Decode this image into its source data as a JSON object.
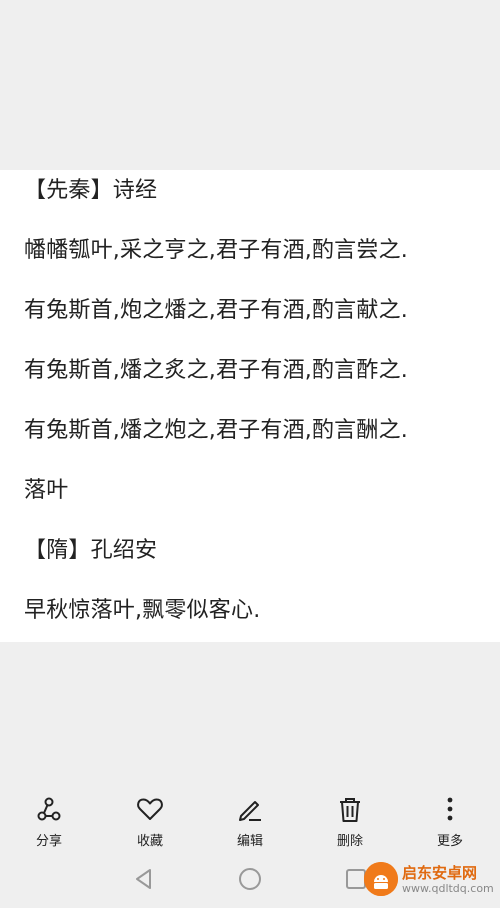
{
  "content": {
    "lines": [
      "【先秦】诗经",
      "幡幡瓠叶,采之亨之,君子有酒,酌言尝之.",
      "有兔斯首,炮之燔之,君子有酒,酌言献之.",
      "有兔斯首,燔之炙之,君子有酒,酌言酢之.",
      "有兔斯首,燔之炮之,君子有酒,酌言酬之.",
      "落叶",
      "【隋】孔绍安",
      "早秋惊落叶,飘零似客心."
    ]
  },
  "toolbar": {
    "share": {
      "label": "分享",
      "icon": "share-icon"
    },
    "favorite": {
      "label": "收藏",
      "icon": "heart-icon"
    },
    "edit": {
      "label": "编辑",
      "icon": "pen-icon"
    },
    "delete": {
      "label": "删除",
      "icon": "trash-icon"
    },
    "more": {
      "label": "更多",
      "icon": "more-vertical-icon"
    }
  },
  "navbar": {
    "back": {
      "icon": "back-triangle-icon"
    },
    "home": {
      "icon": "home-circle-icon"
    },
    "recents": {
      "icon": "recents-square-icon"
    }
  },
  "watermark": {
    "title": "启东安卓网",
    "url": "www.qdltdq.com",
    "color": "#f07a1a"
  }
}
